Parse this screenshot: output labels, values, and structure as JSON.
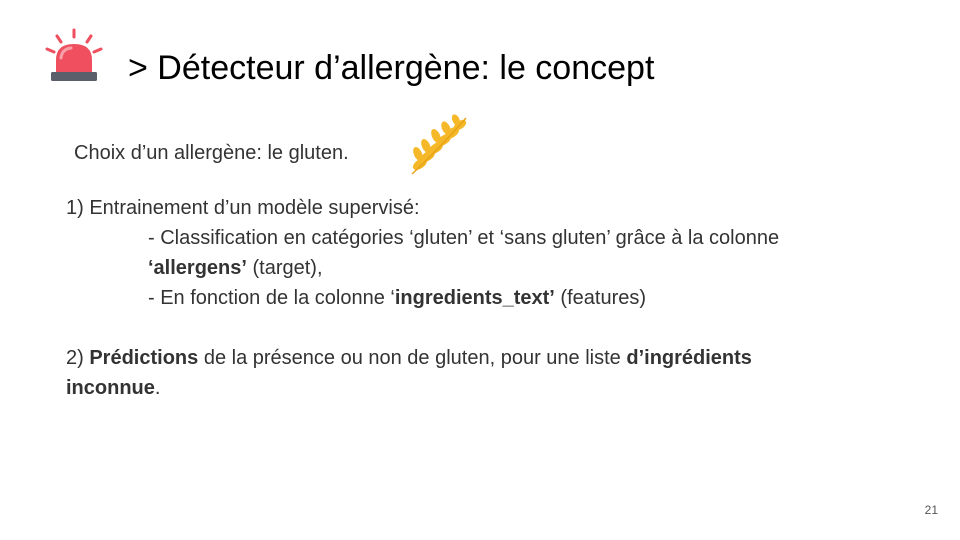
{
  "slide": {
    "title": "> Détecteur d’allergène: le concept",
    "intro": "Choix d’un allergène: le gluten.",
    "step1_heading": "1) Entrainement d’un modèle supervisé:",
    "step1_line1": "- Classification en catégories ‘gluten’ et ‘sans gluten’ grâce à la colonne",
    "step1_line2_bold": "‘allergens’",
    "step1_line2_rest": " (target),",
    "step1_line3_pre": "- En fonction de la colonne ‘",
    "step1_line3_bold": "ingredients_text’",
    "step1_line3_rest": " (features)",
    "step2_prefix": "2) ",
    "step2_bold1": "Prédictions",
    "step2_mid": " de la présence ou non de gluten, pour une liste ",
    "step2_bold2": "d’ingrédients",
    "step2_bold3": "inconnue",
    "step2_end": ".",
    "page_number": "21"
  },
  "icons": {
    "header": "siren-alarm-icon",
    "intro": "wheat-icon"
  },
  "colors": {
    "siren_red": "#EF4F5F",
    "siren_base": "#5A5F6B",
    "wheat_gold": "#F5B829",
    "title": "#000000",
    "text": "#333333"
  }
}
